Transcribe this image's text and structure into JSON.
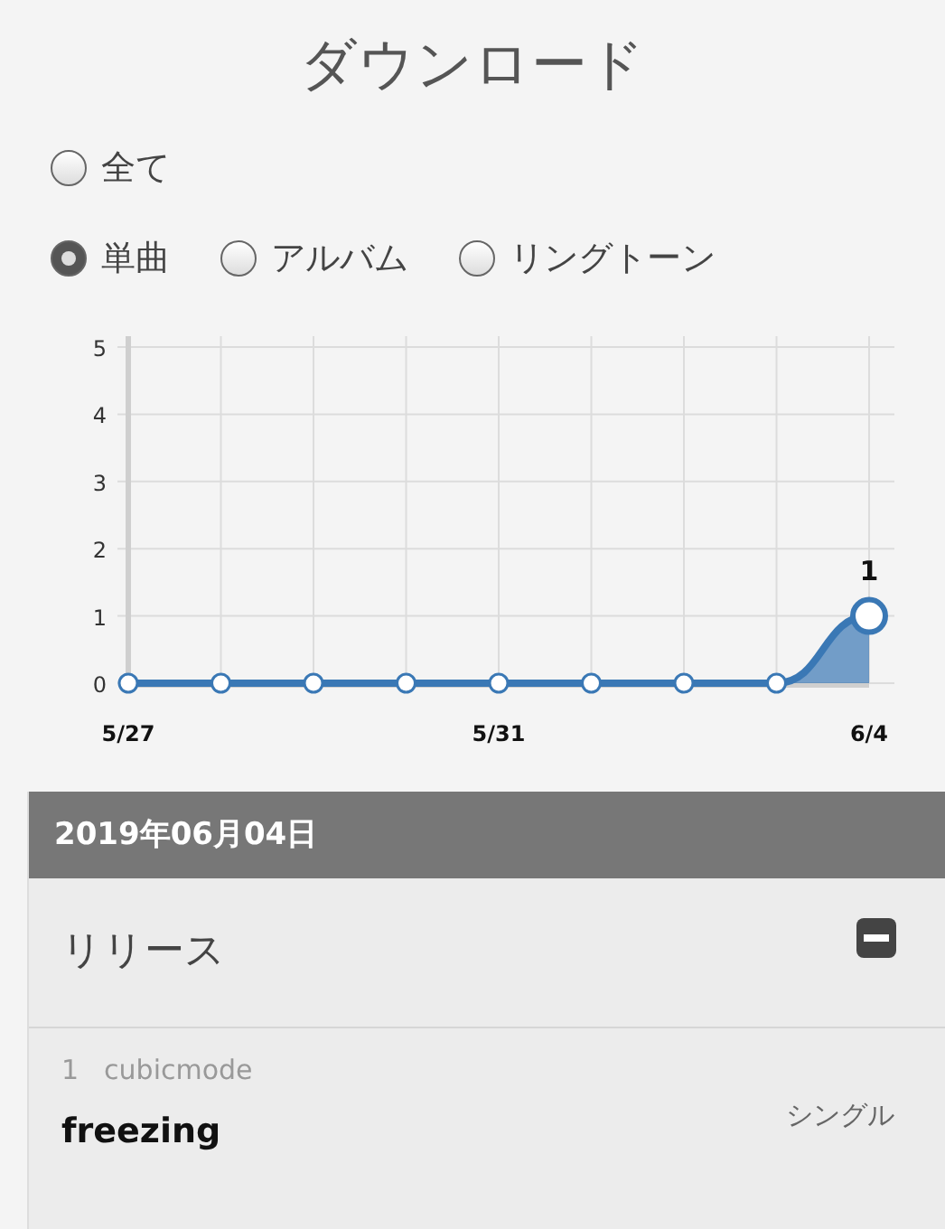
{
  "title": "ダウンロード",
  "filter_rows": [
    {
      "options": [
        {
          "label": "全て",
          "selected": false
        }
      ]
    },
    {
      "options": [
        {
          "label": "単曲",
          "selected": true
        },
        {
          "label": "アルバム",
          "selected": false
        },
        {
          "label": "リングトーン",
          "selected": false
        }
      ]
    }
  ],
  "chart": {
    "chart_data": {
      "type": "area",
      "categories": [
        "5/27",
        null,
        null,
        null,
        "5/31",
        null,
        null,
        null,
        "6/4"
      ],
      "series": [
        {
          "color": "#3a78b5",
          "values": [
            0,
            0,
            0,
            0,
            0,
            0,
            0,
            0,
            1
          ]
        }
      ],
      "ylim": [
        0,
        5
      ],
      "yticks": [
        0,
        1,
        2,
        3,
        4,
        5
      ],
      "grid": true,
      "annotations": [
        {
          "x": "6/4",
          "y": 1,
          "text": "1"
        }
      ]
    }
  },
  "day": {
    "date": "2019年06月04日",
    "section": {
      "title": "リリース",
      "expanded": true,
      "items": [
        {
          "rank": "1",
          "artist": "cubicmode",
          "title": "freezing",
          "type": "シングル"
        }
      ]
    }
  }
}
